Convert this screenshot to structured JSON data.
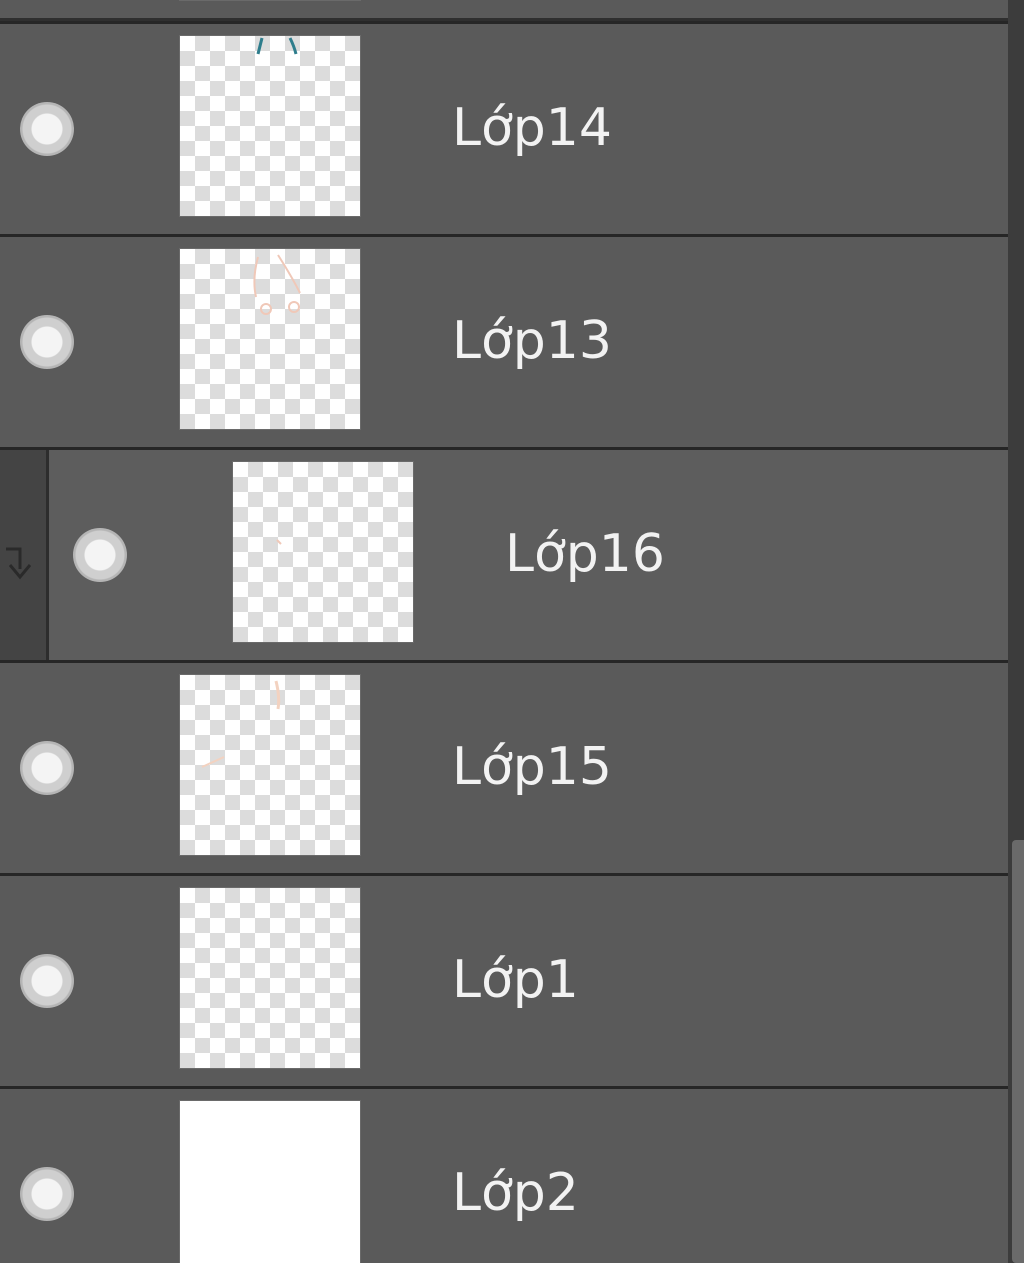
{
  "layers_panel": {
    "layers": [
      {
        "id": "layer-14",
        "name": "Lớp14",
        "visible": true,
        "clipped": false,
        "thumbnail": "transparent"
      },
      {
        "id": "layer-13",
        "name": "Lớp13",
        "visible": true,
        "clipped": false,
        "thumbnail": "transparent"
      },
      {
        "id": "layer-16",
        "name": "Lớp16",
        "visible": true,
        "clipped": true,
        "thumbnail": "transparent"
      },
      {
        "id": "layer-15",
        "name": "Lớp15",
        "visible": true,
        "clipped": false,
        "thumbnail": "transparent"
      },
      {
        "id": "layer-1",
        "name": "Lớp1",
        "visible": true,
        "clipped": false,
        "thumbnail": "transparent"
      },
      {
        "id": "layer-2",
        "name": "Lớp2",
        "visible": true,
        "clipped": false,
        "thumbnail": "white"
      }
    ],
    "icons": {
      "visibility": "eye-icon",
      "clipping": "clipping-arrow-icon"
    },
    "colors": {
      "row_background": "#5a5a5a",
      "separator": "#262626",
      "text": "#f2f2f2",
      "clip_bar": "#444444"
    }
  }
}
